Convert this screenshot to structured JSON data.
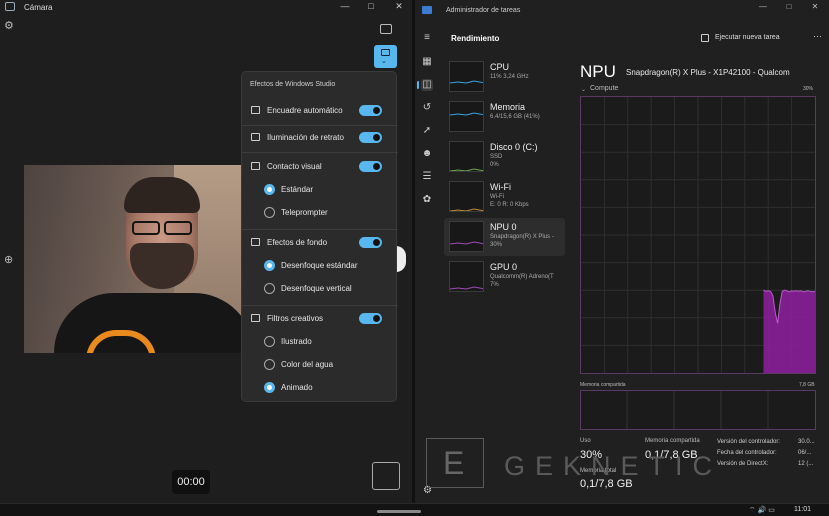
{
  "camera": {
    "title": "Cámara",
    "timer": "00:00",
    "icons": {
      "settings": "gear-icon",
      "switch": "camera-switch-icon",
      "effects": "studio-effects-icon",
      "zoom": "zoom-icon"
    }
  },
  "effects_panel": {
    "title": "Efectos de Windows Studio",
    "auto_framing": {
      "label": "Encuadre automático",
      "on": true
    },
    "portrait_light": {
      "label": "Iluminación de retrato",
      "on": true
    },
    "eye_contact": {
      "label": "Contacto visual",
      "on": true,
      "options": [
        "Estándar",
        "Teleprompter"
      ],
      "selected": "Estándar"
    },
    "background": {
      "label": "Efectos de fondo",
      "on": true,
      "options": [
        "Desenfoque estándar",
        "Desenfoque vertical"
      ],
      "selected": "Desenfoque estándar"
    },
    "creative": {
      "label": "Filtros creativos",
      "on": true,
      "options": [
        "Ilustrado",
        "Color del agua",
        "Animado"
      ],
      "selected": "Animado"
    },
    "accent_color": "#58b8ee"
  },
  "taskmgr": {
    "title": "Administrador de tareas",
    "page": "Rendimiento",
    "run_task": "Ejecutar nueva tarea",
    "resources": [
      {
        "name": "CPU",
        "d1": "11% 3,24 GHz",
        "d2": ""
      },
      {
        "name": "Memoria",
        "d1": "6,4/15,6 GB (41%)",
        "d2": ""
      },
      {
        "name": "Disco 0 (C:)",
        "d1": "SSD",
        "d2": "0%"
      },
      {
        "name": "Wi-Fi",
        "d1": "Wi-Fi",
        "d2": "E: 0 R: 0 Kbps"
      },
      {
        "name": "NPU 0",
        "d1": "Snapdragon(R) X Plus -",
        "d2": "30%"
      },
      {
        "name": "GPU 0",
        "d1": "Qualcomm(R) Adreno(T",
        "d2": "7%"
      }
    ],
    "selected_resource": "NPU 0",
    "detail": {
      "heading": "NPU",
      "model": "Snapdragon(R) X Plus - X1P42100 - Qualcom",
      "graph_label": "Compute",
      "graph_max": "30%",
      "shared_label": "Memoria compartida",
      "shared_max": "7,8 GB",
      "usage_label": "Uso",
      "usage_value": "30%",
      "shared_mem_label": "Memoria compartida",
      "shared_mem_value": "0,1/7,8 GB",
      "total_mem_label": "Memoria total",
      "total_mem_value": "0,1/7,8 GB",
      "driver_version": "Versión del controlador:",
      "driver_version_value": "30.0...",
      "driver_date": "Fecha del controlador:",
      "driver_date_value": "06/...",
      "directx": "Versión de DirectX:",
      "directx_value": "12 (..."
    },
    "npu_utilization_series": [
      0,
      0,
      0,
      0,
      0,
      0,
      0,
      0,
      0,
      0,
      0,
      0,
      0,
      0,
      0,
      0,
      0,
      0,
      0,
      0,
      0,
      0,
      0,
      0,
      0,
      0,
      0,
      0,
      0,
      0,
      0,
      0,
      0,
      0,
      0,
      0,
      0,
      0,
      0,
      0,
      0,
      0,
      0,
      0,
      0,
      0,
      0,
      0,
      0,
      0,
      0,
      0,
      0,
      0,
      0,
      0,
      0,
      0,
      0,
      0,
      0,
      0,
      0,
      0,
      0,
      0,
      0,
      0,
      0,
      0,
      0,
      0,
      0,
      0,
      0,
      0,
      0,
      0,
      30,
      29.6,
      29.8,
      29.6,
      28,
      22,
      18,
      25,
      29.6,
      30,
      29.8,
      29.4,
      29.8,
      29.6,
      29.8,
      29.6,
      29.8,
      29.4,
      29.6,
      29.8,
      29.6,
      29.4,
      29.6
    ],
    "graph_color": "#8a1f9a"
  },
  "watermark": {
    "letter": "E",
    "word": "GEKNETIC"
  },
  "taskbar": {
    "time": "11:01"
  }
}
